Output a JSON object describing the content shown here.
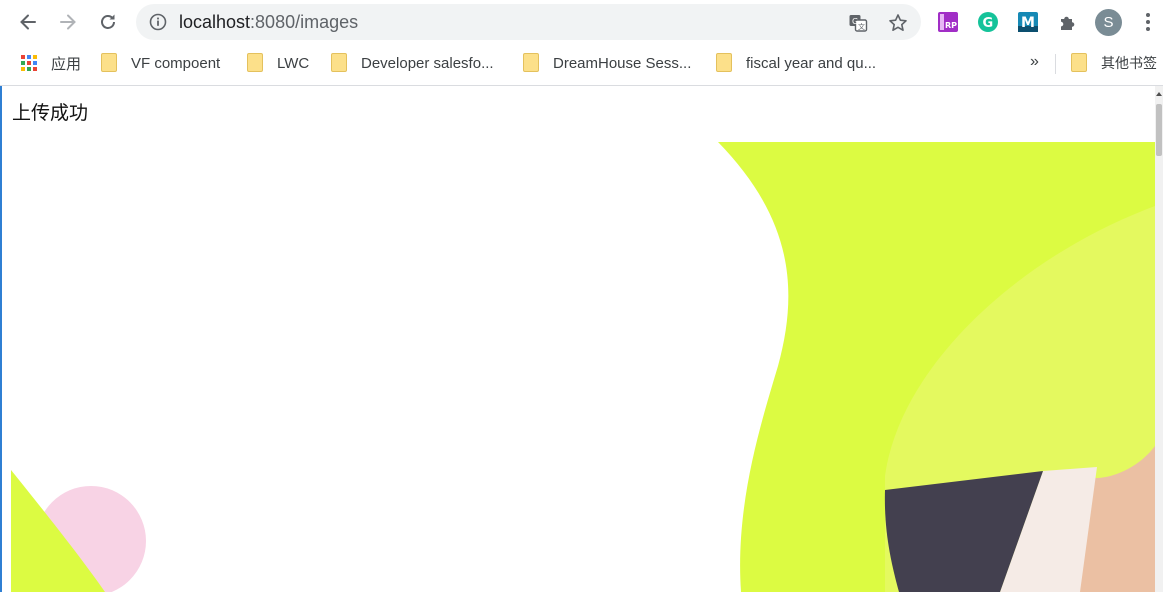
{
  "browser": {
    "url_host": "localhost",
    "url_path": ":8080/images",
    "profile_initial": "S"
  },
  "bookmarks": [
    {
      "label": "应用",
      "type": "apps"
    },
    {
      "label": "VF compoent",
      "type": "folder"
    },
    {
      "label": "LWC",
      "type": "folder"
    },
    {
      "label": "Developer salesfo...",
      "type": "folder"
    },
    {
      "label": "DreamHouse Sess...",
      "type": "folder"
    },
    {
      "label": "fiscal year and qu...",
      "type": "folder"
    }
  ],
  "bookmarks_overflow": "»",
  "other_bookmarks": "其他书签",
  "page": {
    "status_text": "上传成功"
  },
  "colors": {
    "lime": "#dcfb42",
    "lime_light": "#e4f95f",
    "pink": "#f8d3e5",
    "navy": "#43404f",
    "cream": "#f5ebe6",
    "peach": "#ebc0a3"
  }
}
